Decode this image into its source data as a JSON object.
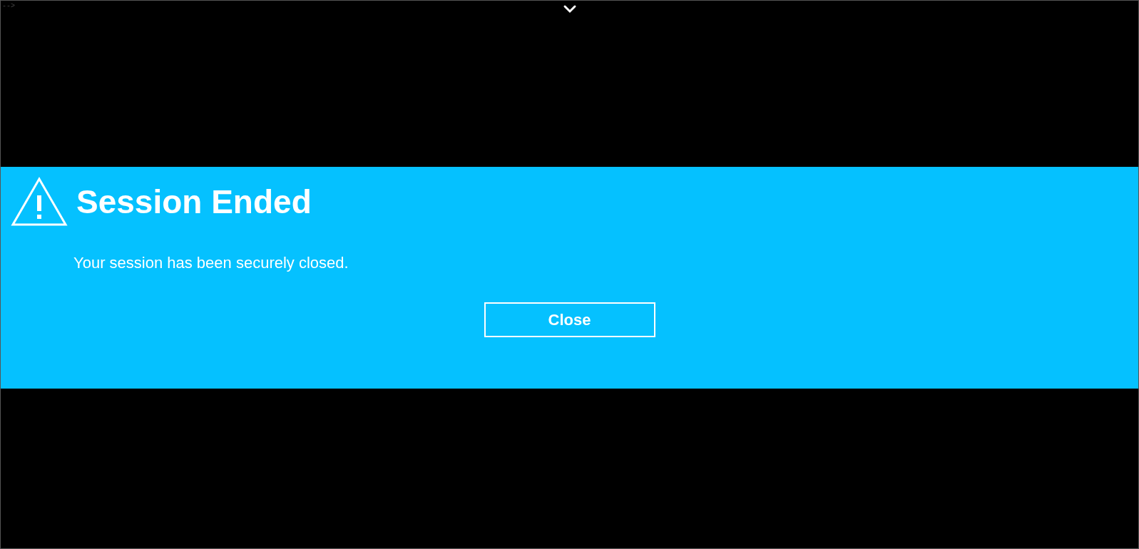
{
  "stray_text": "-->",
  "dialog": {
    "title": "Session Ended",
    "message": "Your session has been securely closed.",
    "buttons": [
      "Close"
    ]
  }
}
